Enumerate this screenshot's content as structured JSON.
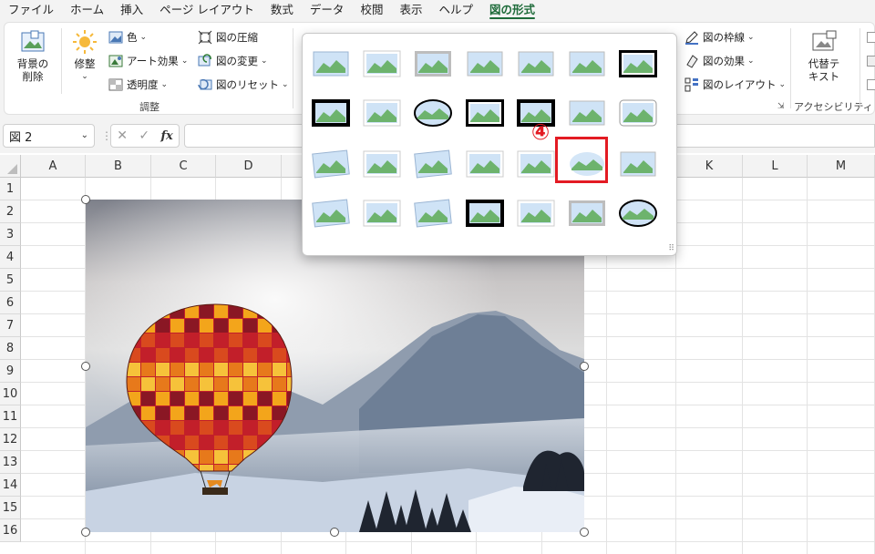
{
  "menu": {
    "items": [
      "ファイル",
      "ホーム",
      "挿入",
      "ページ レイアウト",
      "数式",
      "データ",
      "校閲",
      "表示",
      "ヘルプ",
      "図の形式"
    ],
    "active_index": 9
  },
  "ribbon": {
    "remove_bg": "背景の\n削除",
    "corrections": "修整",
    "color": "色",
    "artistic": "アート効果",
    "transparency": "透明度",
    "compress": "図の圧縮",
    "change": "図の変更",
    "reset": "図のリセット",
    "adjust_group": "調整",
    "border": "図の枠線",
    "effects": "図の効果",
    "layout": "図のレイアウト",
    "alt_text": "代替テ\nキスト",
    "accessibility_group": "アクセシビリティ"
  },
  "formula_bar": {
    "name_box": "図 2",
    "cancel_glyph": "✕",
    "enter_glyph": "✓",
    "fx": "fx",
    "value": ""
  },
  "grid": {
    "visible_columns_left": [
      "A",
      "B",
      "C",
      "D"
    ],
    "visible_columns_right": [
      "K",
      "L",
      "M"
    ],
    "rows": [
      "1",
      "2",
      "3",
      "4",
      "5",
      "6",
      "7",
      "8",
      "9",
      "10",
      "11",
      "12",
      "13",
      "14",
      "15",
      "16"
    ]
  },
  "gallery": {
    "rows": 4,
    "cols": 7,
    "selected_row": 2,
    "selected_col": 5,
    "step_marker": "④"
  },
  "colors": {
    "accent_green": "#1e6b3a",
    "highlight_red": "#e31b23"
  }
}
